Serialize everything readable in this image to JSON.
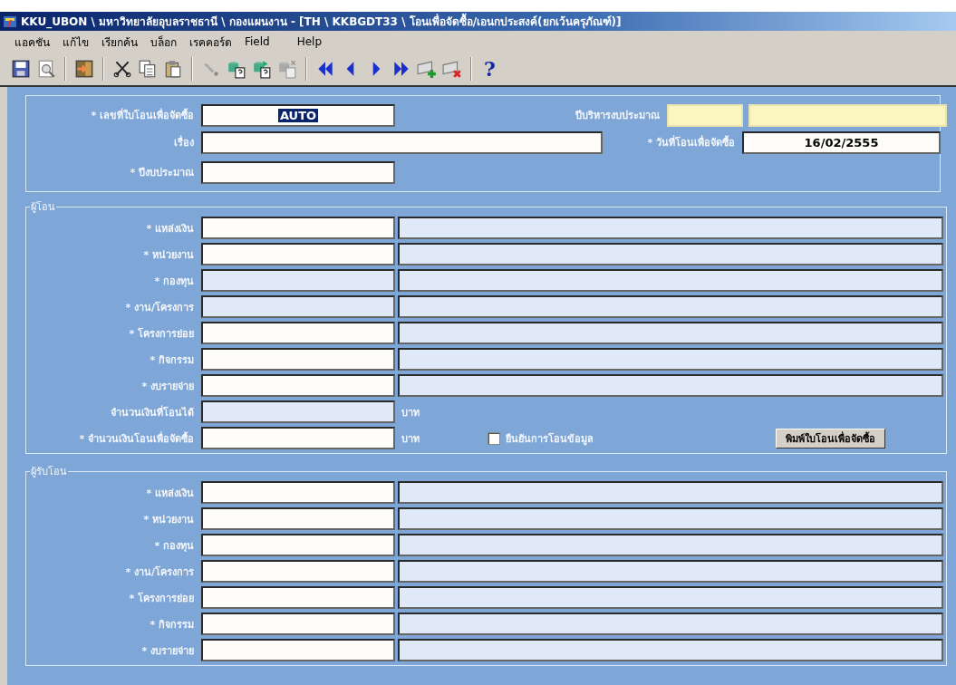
{
  "window": {
    "title": "KKU_UBON \\ มหาวิทยาลัยอุบลราชธานี \\ กองแผนงาน - [TH \\ KKBGDT33 \\ โอนเพื่อจัดซื้อ/เอนกประสงค์(ยกเว้นครุภัณฑ์)]"
  },
  "menu": [
    "แอคชัน",
    "แก้ไข",
    "เรียกค้น",
    "บล็อก",
    "เรคคอร์ด",
    "Field",
    "Help"
  ],
  "toolbar": {
    "help_label": "?"
  },
  "header": {
    "doc_no": {
      "label": "* เลขที่ใบโอนเพื่อจัดซื้อ",
      "value": "AUTO",
      "kind": "editable",
      "value_selected": true
    },
    "admin_year": {
      "label": "ปีบริหารงบประมาณ",
      "fields": [
        {
          "kind": "highlight"
        },
        {
          "kind": "highlight"
        }
      ]
    },
    "subject": {
      "label": "เรื่อง",
      "kind": "editable"
    },
    "transfer_date": {
      "label": "* วันที่โอนเพื่อจัดซื้อ",
      "value": "16/02/2555",
      "kind": "editable"
    },
    "budget_year": {
      "label": "* ปีงบประมาณ",
      "kind": "editable"
    }
  },
  "giver": {
    "legend": "ผู้โอน",
    "rows": [
      {
        "label": "* แหล่งเงิน",
        "code": {
          "kind": "editable"
        },
        "name": {
          "kind": "locked"
        }
      },
      {
        "label": "* หน่วยงาน",
        "code": {
          "kind": "editable"
        },
        "name": {
          "kind": "locked"
        }
      },
      {
        "label": "* กองทุน",
        "code": {
          "kind": "locked"
        },
        "name": {
          "kind": "locked"
        }
      },
      {
        "label": "* งาน/โครงการ",
        "code": {
          "kind": "locked"
        },
        "name": {
          "kind": "locked"
        }
      },
      {
        "label": "* โครงการย่อย",
        "code": {
          "kind": "editable"
        },
        "name": {
          "kind": "locked"
        }
      },
      {
        "label": "* กิจกรรม",
        "code": {
          "kind": "editable"
        },
        "name": {
          "kind": "locked"
        }
      },
      {
        "label": "* งบรายจ่าย",
        "code": {
          "kind": "editable"
        },
        "name": {
          "kind": "locked"
        }
      }
    ],
    "available": {
      "label": "จำนวนเงินที่โอนได้",
      "kind": "locked",
      "unit": "บาท"
    },
    "amount": {
      "label": "* จำนวนเงินโอนเพื่อจัดซื้อ",
      "kind": "editable",
      "unit": "บาท"
    },
    "confirm": {
      "label": "ยืนยันการโอนข้อมูล",
      "checked": false
    },
    "print_button": "พิมพ์ใบโอนเพื่อจัดซื้อ"
  },
  "receiver": {
    "legend": "ผู้รับโอน",
    "rows": [
      {
        "label": "* แหล่งเงิน",
        "code": {
          "kind": "editable"
        },
        "name": {
          "kind": "locked"
        }
      },
      {
        "label": "* หน่วยงาน",
        "code": {
          "kind": "editable"
        },
        "name": {
          "kind": "locked"
        }
      },
      {
        "label": "* กองทุน",
        "code": {
          "kind": "editable"
        },
        "name": {
          "kind": "locked"
        }
      },
      {
        "label": "* งาน/โครงการ",
        "code": {
          "kind": "editable"
        },
        "name": {
          "kind": "locked"
        }
      },
      {
        "label": "* โครงการย่อย",
        "code": {
          "kind": "editable"
        },
        "name": {
          "kind": "locked"
        }
      },
      {
        "label": "* กิจกรรม",
        "code": {
          "kind": "editable"
        },
        "name": {
          "kind": "locked"
        }
      },
      {
        "label": "* งบรายจ่าย",
        "code": {
          "kind": "editable"
        },
        "name": {
          "kind": "locked"
        }
      }
    ]
  }
}
